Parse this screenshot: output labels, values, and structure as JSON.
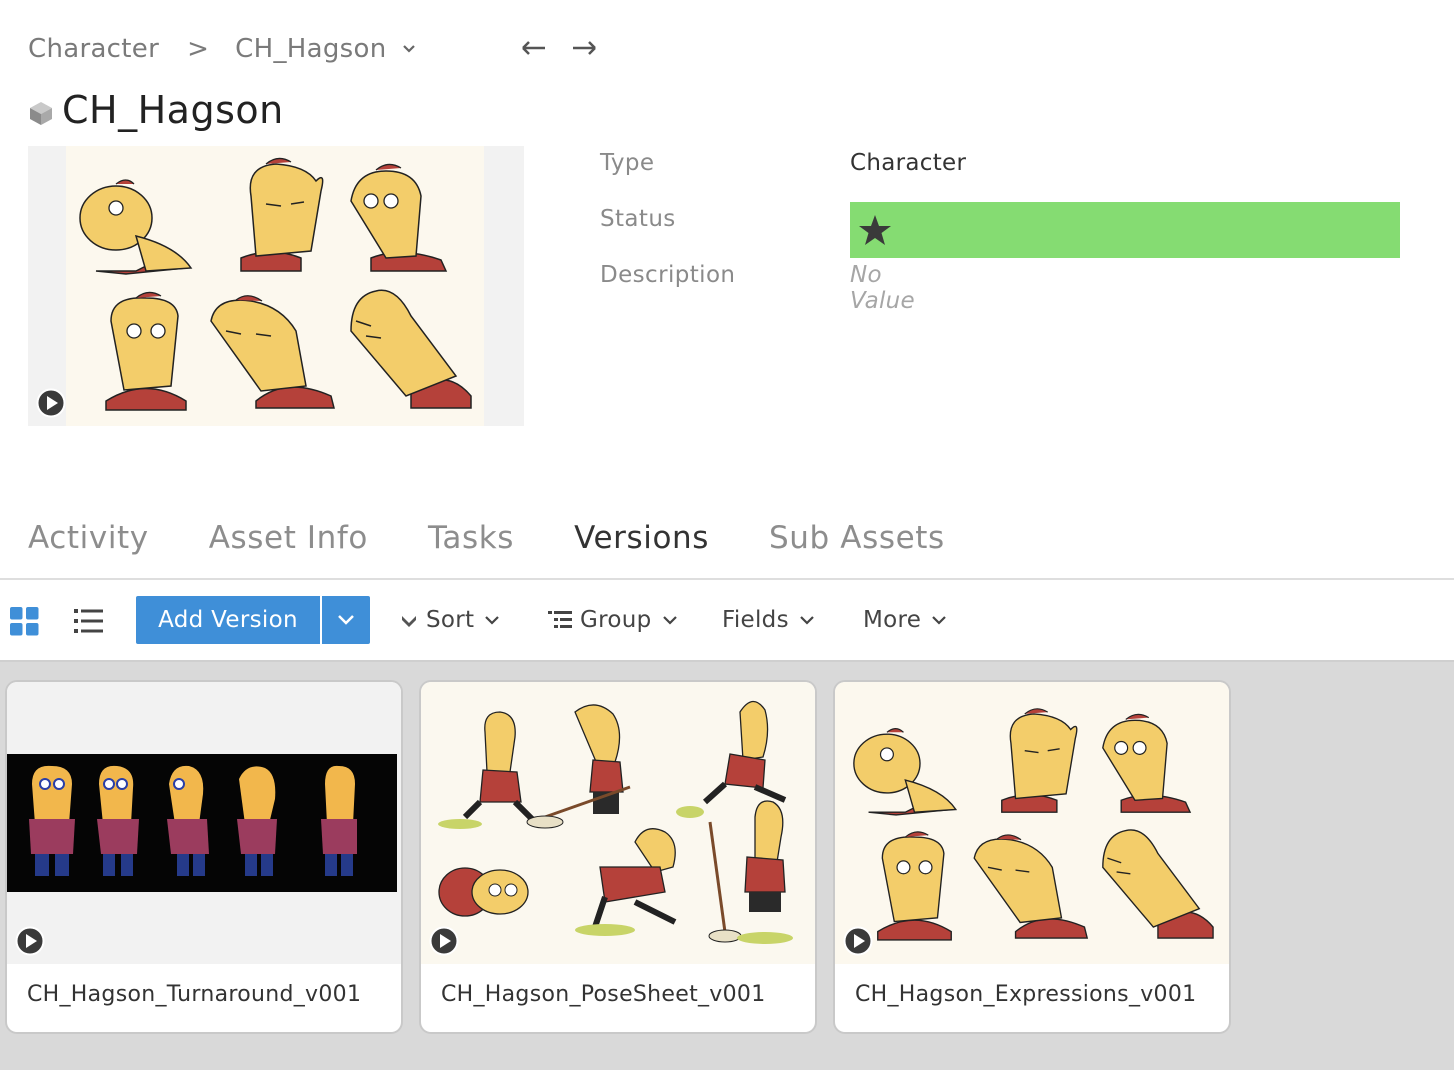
{
  "breadcrumb": {
    "parent": "Character",
    "separator": ">",
    "current": "CH_Hagson"
  },
  "nav": {
    "back_icon": "arrow-left-icon",
    "forward_icon": "arrow-right-icon"
  },
  "asset": {
    "title": "CH_Hagson",
    "icon": "cube-icon"
  },
  "fields": {
    "type_label": "Type",
    "type_value": "Character",
    "status_label": "Status",
    "status_color": "#85dc72",
    "status_icon": "star-icon",
    "description_label": "Description",
    "description_value": "No Value"
  },
  "tabs": [
    {
      "label": "Activity",
      "active": false
    },
    {
      "label": "Asset Info",
      "active": false
    },
    {
      "label": "Tasks",
      "active": false
    },
    {
      "label": "Versions",
      "active": true
    },
    {
      "label": "Sub Assets",
      "active": false
    }
  ],
  "toolbar": {
    "add_version_label": "Add Version",
    "sort_label": "Sort",
    "group_label": "Group",
    "fields_label": "Fields",
    "more_label": "More",
    "accent_color": "#3f8fd8"
  },
  "versions": [
    {
      "name": "CH_Hagson_Turnaround_v001"
    },
    {
      "name": "CH_Hagson_PoseSheet_v001"
    },
    {
      "name": "CH_Hagson_Expressions_v001"
    }
  ]
}
